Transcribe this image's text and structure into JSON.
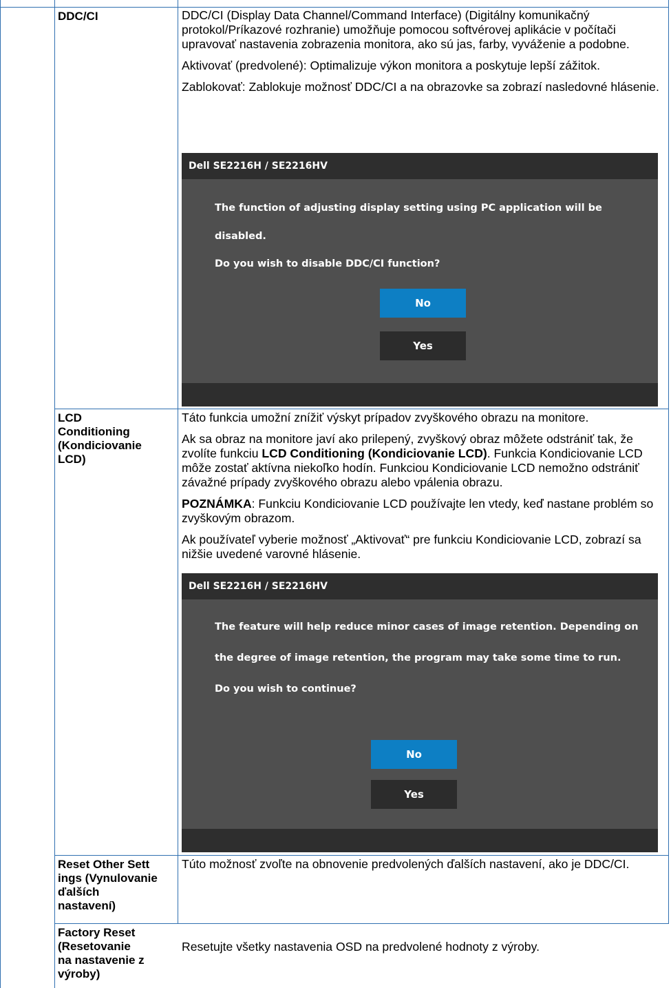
{
  "rows": [
    {
      "name": "DDC/CI",
      "paragraphs": [
        "DDC/CI (Display Data Channel/Command Interface) (Digitálny komunikačný protokol/Príkazové rozhranie) umožňuje pomocou softvérovej aplikácie v počítači upravovať nastavenia zobrazenia monitora, ako sú jas, farby, vyváženie a podobne.",
        "Aktivovať (predvolené): Optimalizuje výkon monitora a poskytuje lepší zážitok.",
        "Zablokovať: Zablokuje možnosť DDC/CI a na obrazovke sa zobrazí nasledovné hlásenie."
      ],
      "dialog": {
        "title": "Dell SE2216H / SE2216HV",
        "line1": "The function of adjusting display setting using PC application will be",
        "line2": "disabled.",
        "line3": "Do you wish to disable DDC/CI function?",
        "no_label": "No",
        "yes_label": "Yes"
      }
    },
    {
      "name_lines": [
        "LCD",
        "Conditioning",
        "(Kondiciovanie",
        "LCD)"
      ],
      "p1": "Táto funkcia umožní znížiť výskyt prípadov zvyškového obrazu na monitore.",
      "p2_before": "Ak sa obraz na monitore javí ako prilepený, zvyškový obraz môžete odstrániť tak, že zvolíte funkciu ",
      "p2_bold": "LCD Conditioning (Kondiciovanie LCD)",
      "p2_after": ". Funkcia Kondiciovanie LCD môže zostať aktívna niekoľko hodín. Funkciou Kondiciovanie LCD nemožno odstrániť závažné prípady zvyškového obrazu alebo vpálenia obrazu.",
      "note_label": "POZNÁMKA",
      "note_text": ": Funkciu Kondiciovanie LCD používajte len vtedy, keď nastane problém so zvyškovým obrazom.",
      "p4": "Ak používateľ vyberie možnosť „Aktivovať“ pre funkciu Kondiciovanie LCD, zobrazí sa nižšie uvedené varovné hlásenie.",
      "dialog": {
        "title": "Dell SE2216H / SE2216HV",
        "line1": "The feature will help reduce minor cases of image retention. Depending on",
        "line2": "the degree of image retention, the program may take some time to run.",
        "line3": "Do you wish to continue?",
        "no_label": "No",
        "yes_label": "Yes"
      }
    },
    {
      "name_lines": [
        "Reset Other Sett",
        "ings (Vynulovanie",
        "ďalších",
        "nastavení)"
      ],
      "text": "Túto možnosť zvoľte na obnovenie predvolených ďalších nastavení, ako je DDC/CI."
    },
    {
      "name_lines": [
        "Factory Reset",
        "(Resetovanie",
        "na nastavenie z",
        "výroby)"
      ],
      "text": "Resetujte všetky nastavenia OSD na predvolené hodnoty z výroby."
    }
  ],
  "colors": {
    "rule": "#2f6fb0",
    "osd_body": "#4f4f4f",
    "osd_bar": "#2e2e2e",
    "osd_primary": "#0d7fc4",
    "osd_secondary": "#2c2c2c"
  }
}
